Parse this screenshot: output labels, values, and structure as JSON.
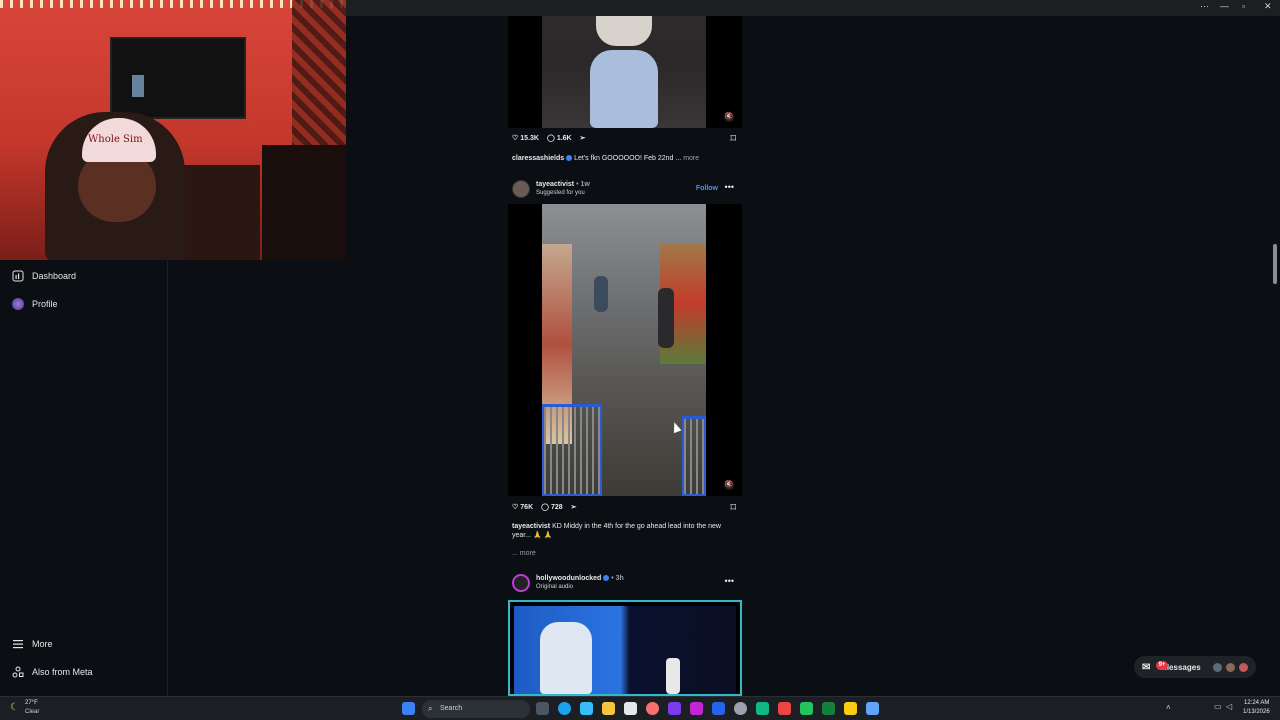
{
  "sidebar": {
    "items": [
      {
        "label": "Dashboard",
        "icon": "dashboard-icon"
      },
      {
        "label": "Profile",
        "icon": "profile-avatar-icon"
      },
      {
        "label": "More",
        "icon": "hamburger-menu-icon"
      },
      {
        "label": "Also from Meta",
        "icon": "meta-apps-icon"
      }
    ]
  },
  "posts": [
    {
      "likes": "15.3K",
      "comments": "1.6K",
      "caption_user": "claressashields",
      "caption_text": "Let's fkn GOOOOOO! Feb 22nd ...",
      "more": "more"
    },
    {
      "username": "tayeactivist",
      "time": "• 1w",
      "subtitle": "Suggested for you",
      "follow": "Follow",
      "likes": "76K",
      "comments": "728",
      "caption_user": "tayeactivist",
      "caption_text": "KD Middy in the 4th for the go ahead lead into the new year... 🙏 🙏",
      "more": "... more"
    },
    {
      "username": "hollywoodunlocked",
      "time": "• 3h",
      "subtitle": "Original audio"
    }
  ],
  "messages": {
    "label": "Messages",
    "badge": "9+"
  },
  "taskbar": {
    "weather_temp": "27°F",
    "weather_desc": "Clear",
    "search_label": "Search",
    "time": "12:24 AM",
    "date": "1/13/2026"
  },
  "colors": {
    "accent": "#4a8ff7",
    "background": "#0b0f13",
    "badge": "#e53945"
  }
}
